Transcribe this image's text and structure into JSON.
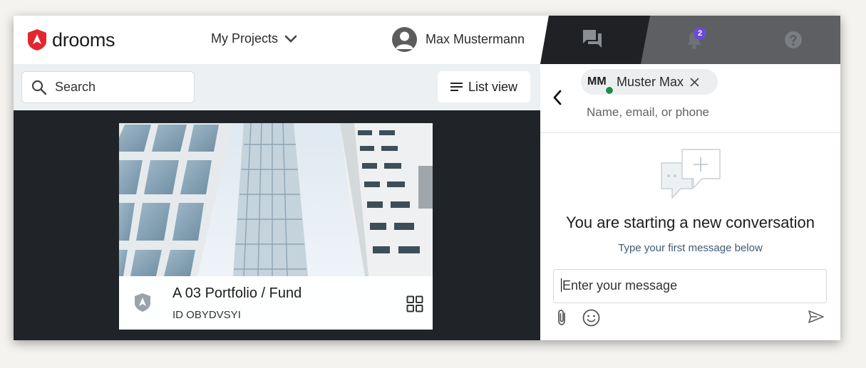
{
  "brand": {
    "name": "drooms",
    "color": "#e3262f"
  },
  "header": {
    "projects_label": "My Projects",
    "user_name": "Max Mustermann"
  },
  "toolbar": {
    "search_placeholder": "Search",
    "list_view_label": "List view"
  },
  "project_card": {
    "title": "A 03 Portfolio / Fund",
    "id_text": "ID OBYDVSYI"
  },
  "chat_panel": {
    "tabs": [
      {
        "icon": "chat-icon",
        "active": true
      },
      {
        "icon": "bell-icon",
        "badge": "2"
      },
      {
        "icon": "help-icon"
      }
    ],
    "recipient": {
      "initials": "MM",
      "name": "Muster Max",
      "status_color": "#1f8a4c",
      "input_placeholder": "Name, email, or phone"
    },
    "empty_state": {
      "title": "You are starting a new conversation",
      "subtitle": "Type your first message below"
    },
    "message_input_placeholder": "Enter your message"
  },
  "colors": {
    "badge": "#6c4bd8",
    "dark_bg": "#202428",
    "toolbar_bg": "#edf0f3"
  }
}
